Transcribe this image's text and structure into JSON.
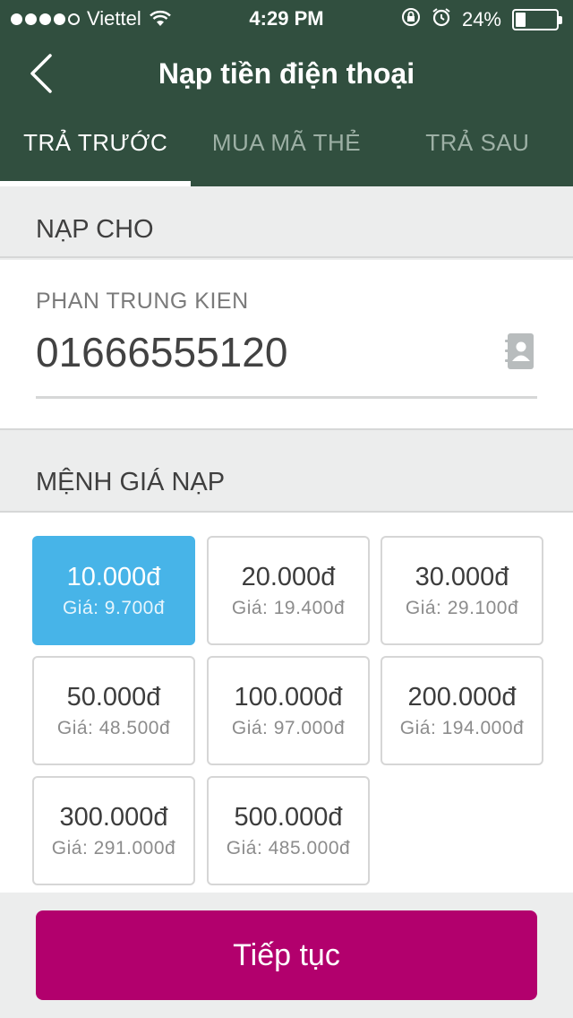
{
  "status_bar": {
    "carrier": "Viettel",
    "time": "4:29 PM",
    "battery_percent": "24%",
    "battery_level": 0.24,
    "signal_bars": 4,
    "signal_total": 5
  },
  "header": {
    "title": "Nạp tiền điện thoại",
    "background_color": "#314f3f"
  },
  "tabs": [
    {
      "label": "TRẢ TRƯỚC",
      "active": true
    },
    {
      "label": "MUA MÃ THẺ",
      "active": false
    },
    {
      "label": "TRẢ SAU",
      "active": false
    }
  ],
  "recipient_section": {
    "title": "NẠP CHO",
    "name": "PHAN TRUNG KIEN",
    "phone": "01666555120",
    "contact_icon": "contact-book-icon"
  },
  "denomination_section": {
    "title": "MỆNH GIÁ NẠP",
    "selected_color": "#47b4e8",
    "options": [
      {
        "amount": "10.000đ",
        "price": "Giá: 9.700đ",
        "selected": true
      },
      {
        "amount": "20.000đ",
        "price": "Giá: 19.400đ",
        "selected": false
      },
      {
        "amount": "30.000đ",
        "price": "Giá: 29.100đ",
        "selected": false
      },
      {
        "amount": "50.000đ",
        "price": "Giá: 48.500đ",
        "selected": false
      },
      {
        "amount": "100.000đ",
        "price": "Giá: 97.000đ",
        "selected": false
      },
      {
        "amount": "200.000đ",
        "price": "Giá: 194.000đ",
        "selected": false
      },
      {
        "amount": "300.000đ",
        "price": "Giá: 291.000đ",
        "selected": false
      },
      {
        "amount": "500.000đ",
        "price": "Giá: 485.000đ",
        "selected": false
      }
    ]
  },
  "footer": {
    "continue_label": "Tiếp tục",
    "button_color": "#b2006d"
  }
}
